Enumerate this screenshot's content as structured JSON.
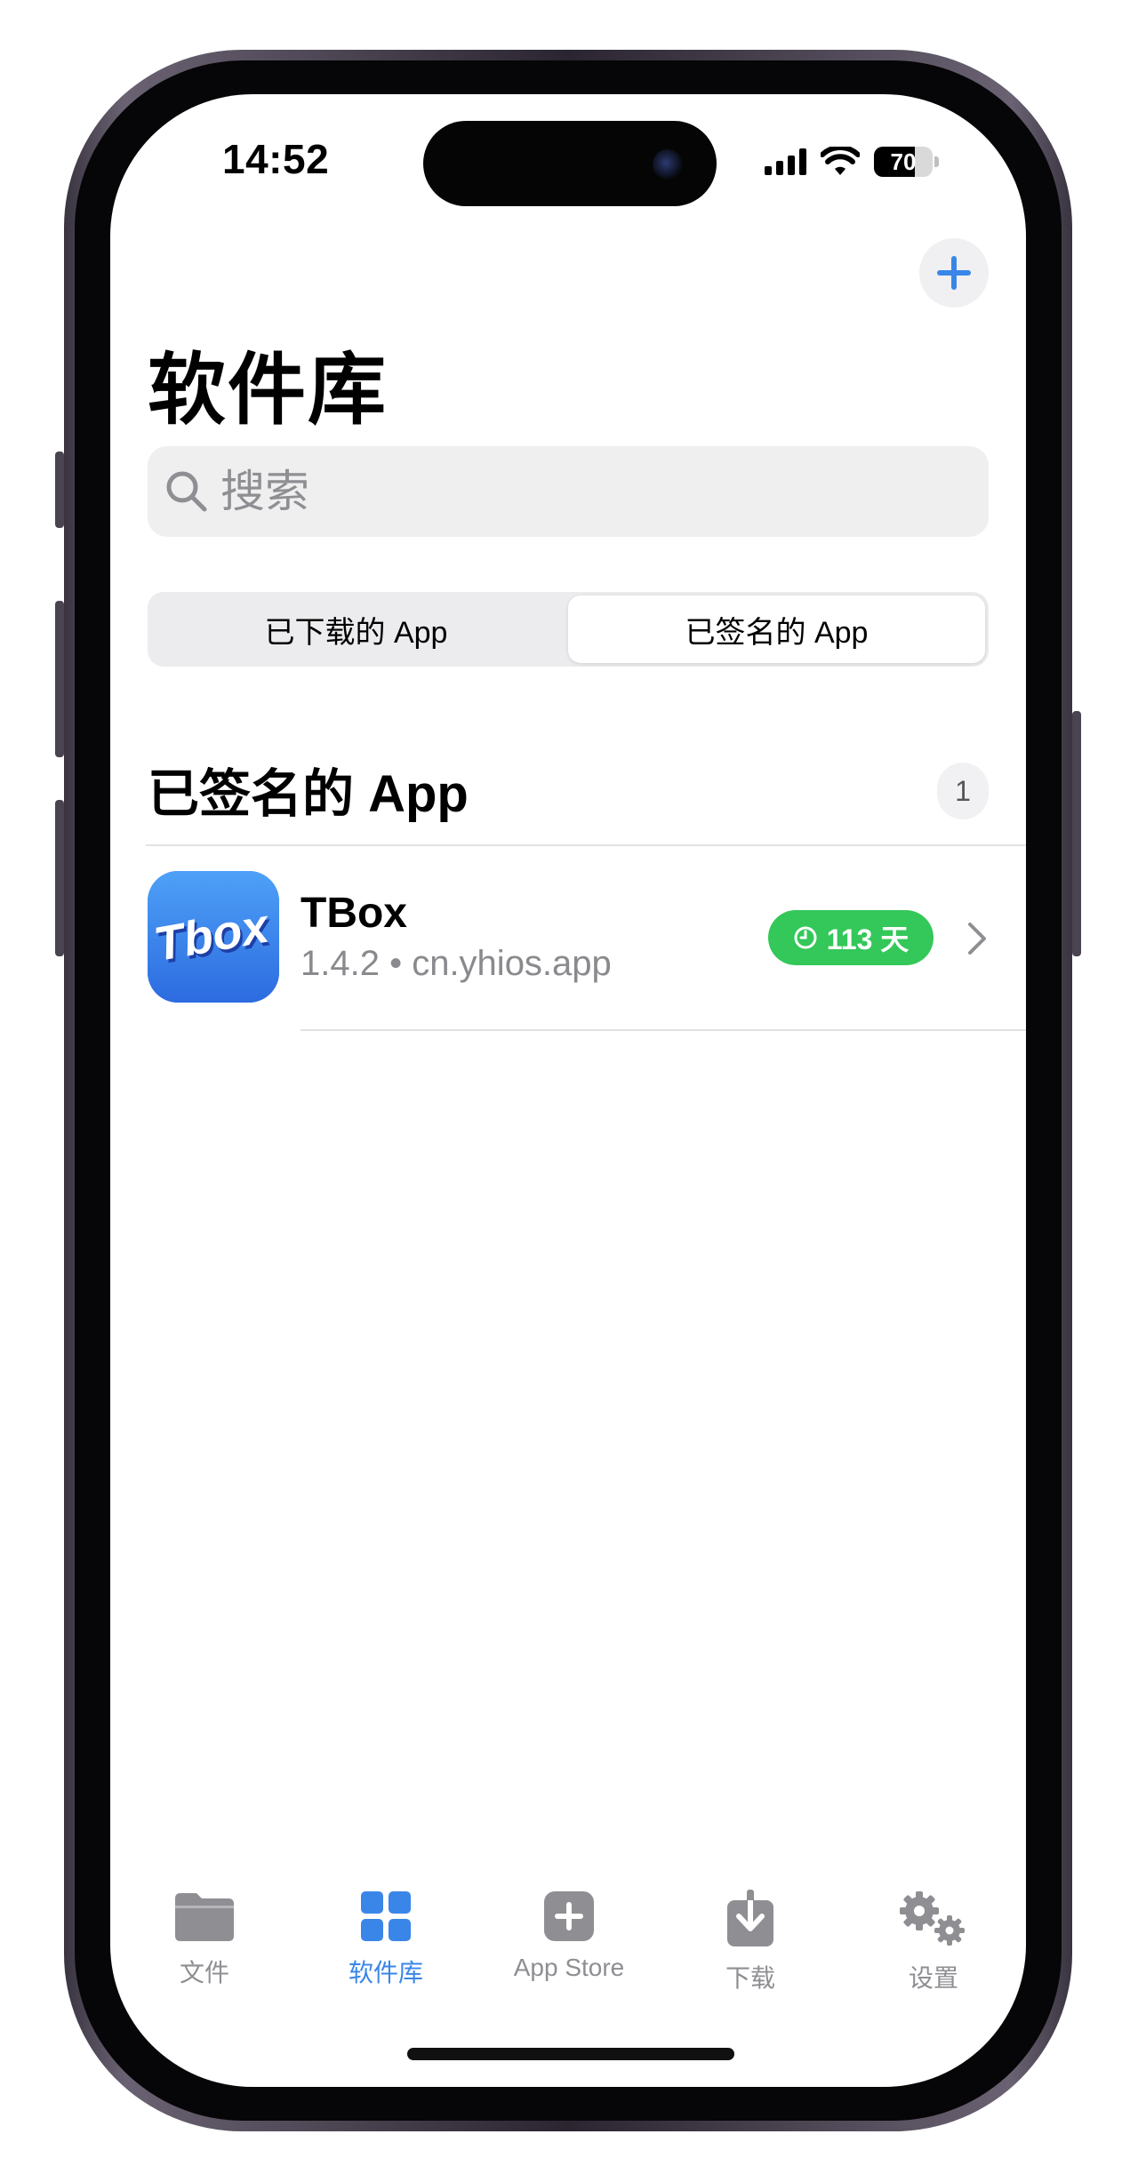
{
  "status": {
    "time": "14:52",
    "battery_percent": "70",
    "battery_level": 0.7,
    "signal_icon": "cellular-signal-icon",
    "wifi_icon": "wifi-icon"
  },
  "header": {
    "add_icon": "plus-icon",
    "title": "软件库"
  },
  "search": {
    "placeholder": "搜索"
  },
  "segments": {
    "downloaded": "已下载的 App",
    "signed": "已签名的 App",
    "selected": "signed"
  },
  "section": {
    "title": "已签名的 App",
    "count": "1"
  },
  "apps": [
    {
      "name": "TBox",
      "icon_text": "Tbox",
      "version": "1.4.2",
      "separator": "•",
      "bundle_id": "cn.yhios.app",
      "subtitle": "1.4.2 • cn.yhios.app",
      "days_left": "113 天"
    }
  ],
  "tabbar": {
    "items": [
      {
        "label": "文件",
        "icon": "folder-icon"
      },
      {
        "label": "软件库",
        "icon": "grid-icon"
      },
      {
        "label": "App Store",
        "icon": "plus-square-icon"
      },
      {
        "label": "下载",
        "icon": "download-icon"
      },
      {
        "label": "设置",
        "icon": "gears-icon"
      }
    ],
    "active_index": 1
  },
  "colors": {
    "accent": "#3a86e8",
    "badge_green": "#34c759",
    "tab_inactive": "#8e8e93"
  }
}
